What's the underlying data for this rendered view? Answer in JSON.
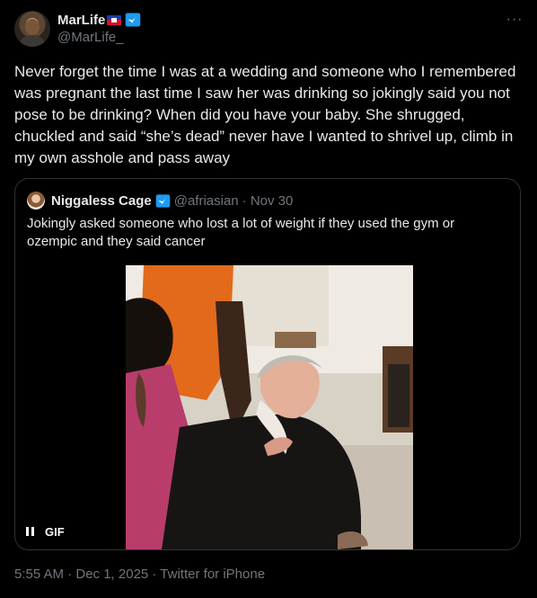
{
  "tweet": {
    "author": {
      "name": "MarLife",
      "handle": "@MarLife_"
    },
    "text": "Never forget the time I was at a wedding and someone who I remembered was pregnant the last time I saw her was drinking so jokingly said you not pose to be drinking? When did you have your baby. She shrugged, chuckled and said “she’s dead” never have I wanted to shrivel up, climb in my own asshole and pass away",
    "quote": {
      "name": "Niggaless Cage",
      "handle": "@afriasian",
      "date": "· Nov 30",
      "text": "Jokingly asked someone who lost a lot of weight if they used the gym or ozempic and they said cancer",
      "media": {
        "badge": "GIF"
      }
    },
    "meta": "5:55 AM · Dec 1, 2025 · Twitter for iPhone"
  },
  "colors": {
    "background": "#000000",
    "text": "#e7e9ea",
    "secondary": "#71767b",
    "verified_blue": "#1d9bf0",
    "border": "#2f3336"
  },
  "icons": {
    "verified": "verified-badge-icon",
    "flag": "haiti-flag-icon",
    "more": "more-icon",
    "pause": "pause-icon"
  }
}
